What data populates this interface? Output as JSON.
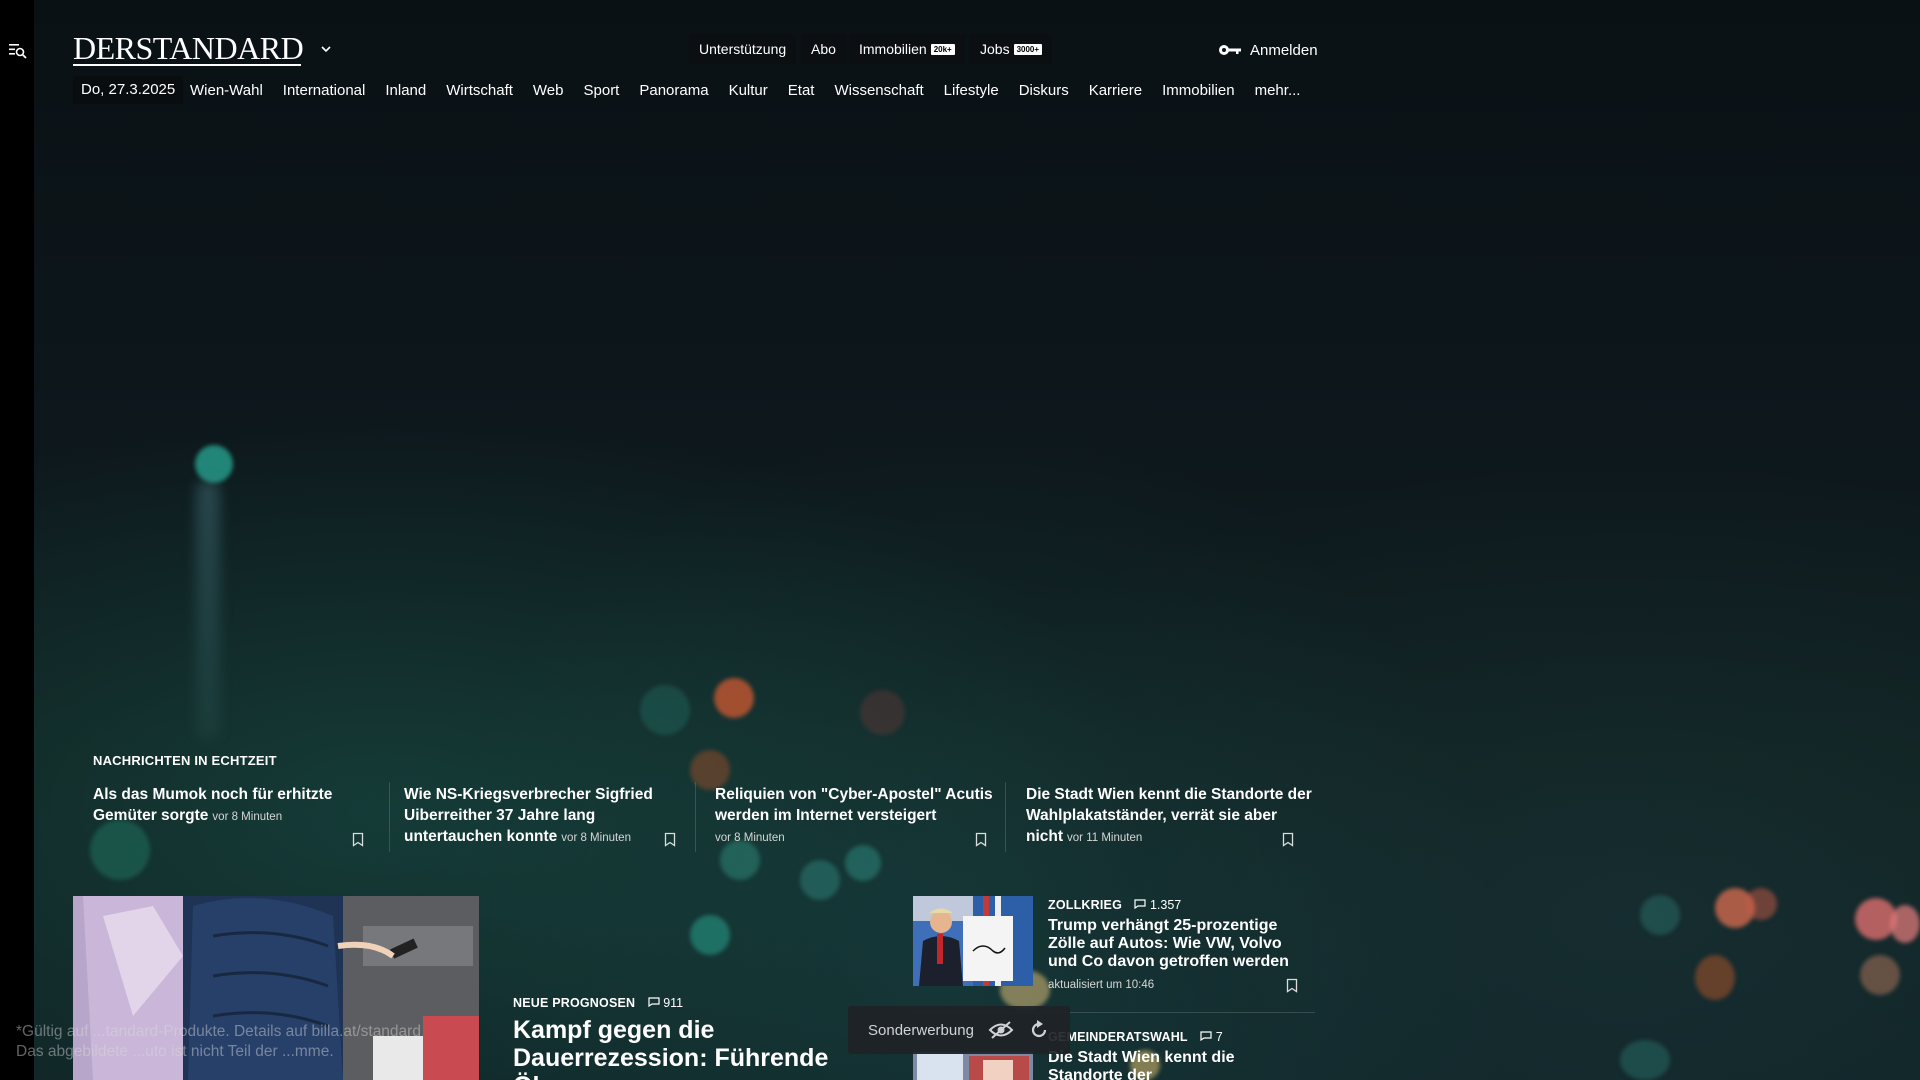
{
  "header": {
    "logo_text": "DERSTANDARD",
    "top_links": [
      {
        "label": "Unterstützung"
      },
      {
        "label": "Abo"
      },
      {
        "label": "Immobilien",
        "badge": "20k+"
      },
      {
        "label": "Jobs",
        "badge": "3000+"
      }
    ],
    "login_label": "Anmelden"
  },
  "nav": {
    "date": "Do, 27.3.2025",
    "items": [
      "Wien-Wahl",
      "International",
      "Inland",
      "Wirtschaft",
      "Web",
      "Sport",
      "Panorama",
      "Kultur",
      "Etat",
      "Wissenschaft",
      "Lifestyle",
      "Diskurs",
      "Karriere",
      "Immobilien",
      "mehr..."
    ]
  },
  "realtime": {
    "heading": "NACHRICHTEN IN ECHTZEIT",
    "items": [
      {
        "title": "Als das Mumok noch für erhitzte Gemüter sorgte",
        "time": "vor 8 Minuten"
      },
      {
        "title": "Wie NS-Kriegsverbrecher Sigfried Uiberreither 37 Jahre lang untertauchen konnte",
        "time": "vor 8 Minuten"
      },
      {
        "title": "Reliquien von \"Cyber-Apostel\" Acutis werden im Internet versteigert",
        "time": "vor 8 Minuten"
      },
      {
        "title": "Die Stadt Wien kennt die Standorte der Wahlplakatständer, verrät sie aber nicht",
        "time": "vor 11 Minuten"
      }
    ]
  },
  "lead": {
    "kicker": "NEUE PROGNOSEN",
    "comments": "911",
    "title": "Kampf gegen die Dauerrezession: Führende Ök..."
  },
  "side": [
    {
      "kicker": "ZOLLKRIEG",
      "comments": "1.357",
      "title": "Trump verhängt 25-prozentige Zölle auf Autos: Wie VW, Volvo und Co davon getroffen werden",
      "meta": "aktualisiert um 10:46"
    },
    {
      "kicker": "GEMEINDERATSWAHL",
      "comments": "7",
      "title": "Die Stadt Wien kennt die Standorte der"
    }
  ],
  "ad": {
    "label": "Sonderwerbung"
  },
  "disclaimer": {
    "line1": "*Gültig auf ...tandard-Produkte. Details auf billa.at/standard",
    "line2": "Das abgebildete ...uto ist nicht Teil der ...mme."
  },
  "colors": {
    "background": "#0c1418",
    "text": "#ffffff",
    "badge_bg": "#ffffff"
  }
}
